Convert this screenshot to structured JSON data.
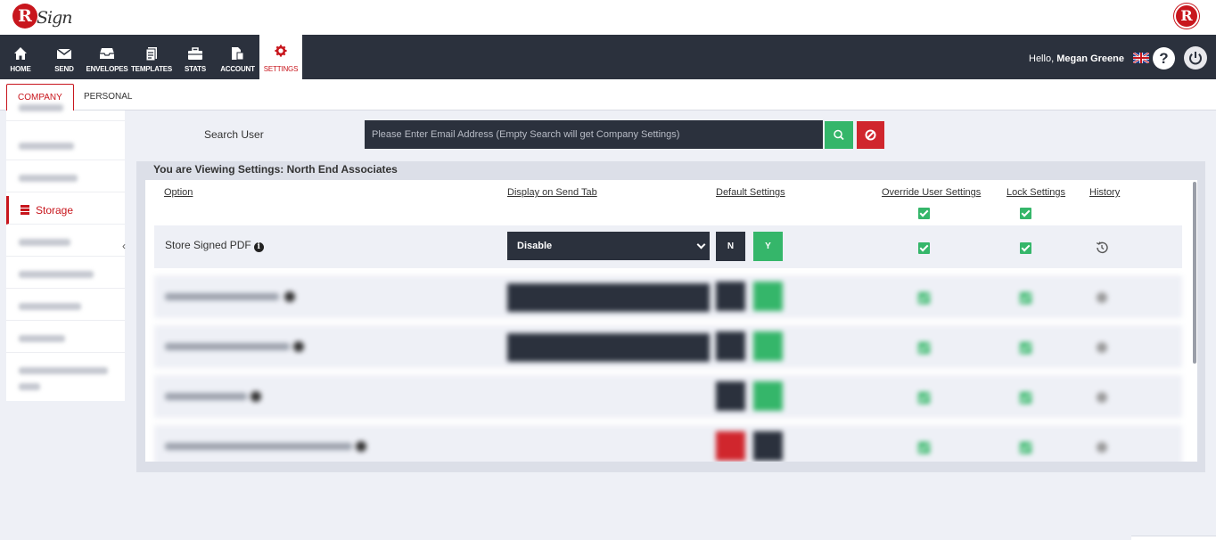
{
  "brand": {
    "logo_letter": "R",
    "logo_word": "Sign",
    "right_logo_letter": "R"
  },
  "nav": {
    "items": [
      {
        "label": "HOME",
        "icon": "home-icon"
      },
      {
        "label": "SEND",
        "icon": "envelope-icon"
      },
      {
        "label": "ENVELOPES",
        "icon": "inbox-icon"
      },
      {
        "label": "TEMPLATES",
        "icon": "templates-icon"
      },
      {
        "label": "STATS",
        "icon": "briefcase-icon"
      },
      {
        "label": "ACCOUNT",
        "icon": "account-icon"
      },
      {
        "label": "SETTINGS",
        "icon": "gear-icon",
        "active": true
      }
    ],
    "greeting_prefix": "Hello, ",
    "user_name": "Megan Greene",
    "help_symbol": "?"
  },
  "tabs": {
    "company": "COMPANY",
    "personal": "PERSONAL"
  },
  "sidebar": {
    "active_label": "Storage",
    "collapse_symbol": "‹"
  },
  "search": {
    "label": "Search User",
    "placeholder": "Please Enter Email Address (Empty Search will get Company Settings)",
    "value": ""
  },
  "panel": {
    "title": "You are Viewing Settings: North End Associates",
    "columns": {
      "option": "Option",
      "display": "Display on Send Tab",
      "default": "Default Settings",
      "override": "Override User Settings",
      "lock": "Lock Settings",
      "history": "History"
    },
    "header_override_checked": true,
    "header_lock_checked": true,
    "rows": [
      {
        "label": "Store Signed PDF",
        "info": "i",
        "display_value": "Disable",
        "btn_n": "N",
        "btn_y": "Y",
        "override_checked": true,
        "lock_checked": true
      }
    ]
  },
  "colors": {
    "dark": "#2b313d",
    "accent_red": "#c8161d",
    "green": "#35b66a",
    "danger": "#d0262d",
    "background": "#eef0f6"
  }
}
